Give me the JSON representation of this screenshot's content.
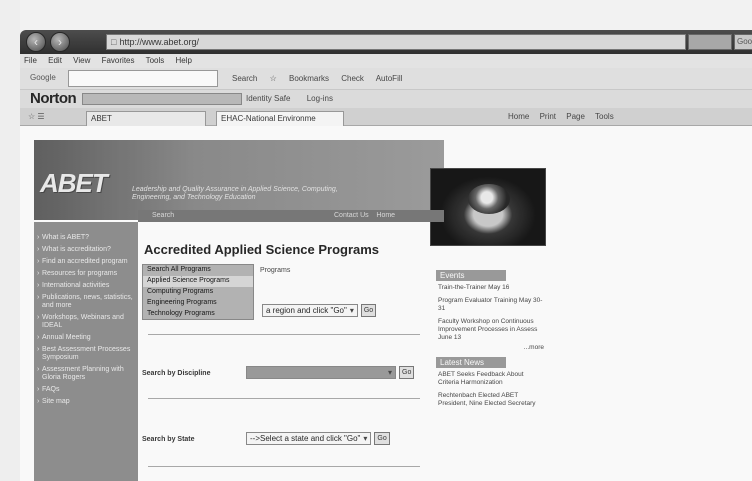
{
  "browser": {
    "url": "http://www.abet.org/",
    "search_right": "Googl",
    "menu": [
      "File",
      "Edit",
      "View",
      "Favorites",
      "Tools",
      "Help"
    ],
    "toolbar": {
      "label": "Google",
      "items": [
        "Search",
        "Bookmarks",
        "Check",
        "AutoFill"
      ]
    },
    "norton": {
      "brand": "Norton",
      "items": [
        "Identity Safe",
        "Log-ins"
      ]
    },
    "tabs": [
      "ABET",
      "EHAC-National Environme"
    ],
    "tools": [
      "Home",
      "Print",
      "Page",
      "Tools"
    ]
  },
  "site": {
    "logo": "ABET",
    "tagline": "Leadership and Quality Assurance in Applied Science, Computing, Engineering, and Technology Education",
    "searchbar": {
      "search": "Search",
      "contact": "Contact Us",
      "home": "Home"
    },
    "sidebar": [
      "What is ABET?",
      "What is accreditation?",
      "Find an accredited program",
      "Resources for programs",
      "International activities",
      "Publications, news, statistics, and more",
      "Workshops, Webinars and IDEAL",
      "Annual Meeting",
      "Best Assessment Processes Symposium",
      "Assessment Planning with Gloria Rogers",
      "FAQs",
      "Site map"
    ],
    "main": {
      "title": "Accredited Applied Science Programs",
      "sub_link": "Programs",
      "dropdown": [
        "Search All Programs",
        "Applied Science Programs",
        "Computing Programs",
        "Engineering Programs",
        "Technology Programs"
      ],
      "region": {
        "select": "a region and click \"Go\"",
        "go": "Go"
      },
      "discipline": {
        "label": "Search by Discipline",
        "select": "",
        "go": "Go"
      },
      "state": {
        "label": "Search by State",
        "select": "-->Select a state and click \"Go\"",
        "go": "Go"
      }
    },
    "events": {
      "title": "Events",
      "items": [
        "Train-the-Trainer May 16",
        "Program Evaluator Training May 30-31",
        "Faculty Workshop on Continuous Improvement Processes in Assess June 13"
      ],
      "more": "...more"
    },
    "news": {
      "title": "Latest News",
      "items": [
        "ABET Seeks Feedback About Criteria Harmonization",
        "Rechtenbach Elected ABET President, Nine Elected Secretary"
      ]
    }
  }
}
